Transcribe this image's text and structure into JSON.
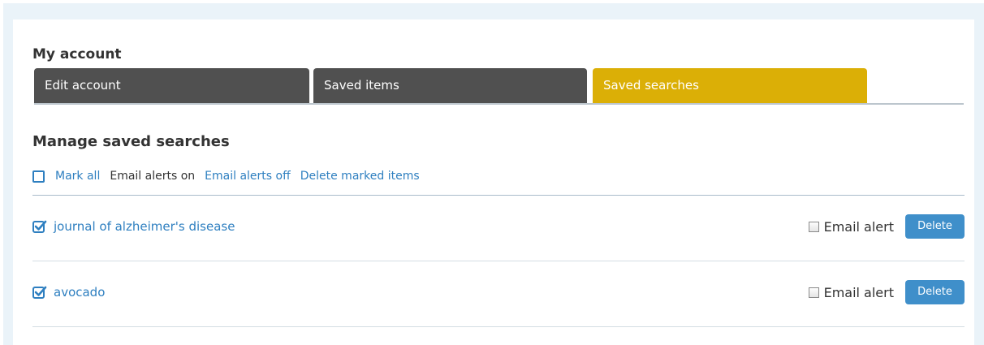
{
  "account": {
    "title": "My account"
  },
  "tabs": [
    {
      "label": "Edit account",
      "active": false
    },
    {
      "label": "Saved items",
      "active": false
    },
    {
      "label": "Saved searches",
      "active": true
    }
  ],
  "manage": {
    "title": "Manage saved searches",
    "mark_all_label": "Mark all",
    "email_on_label": "Email alerts on",
    "email_off_label": "Email alerts off",
    "delete_marked_label": "Delete marked items"
  },
  "searches": [
    {
      "name": "journal of alzheimer's disease",
      "checked": true,
      "email_alert_label": "Email alert",
      "email_alert_checked": false,
      "delete_label": "Delete"
    },
    {
      "name": "avocado",
      "checked": true,
      "email_alert_label": "Email alert",
      "email_alert_checked": false,
      "delete_label": "Delete"
    }
  ],
  "colors": {
    "tab_dark": "#505050",
    "tab_active": "#dbaf06",
    "link": "#2e7fc0",
    "button": "#3f8fca",
    "page_bg": "#eaf3f9"
  }
}
